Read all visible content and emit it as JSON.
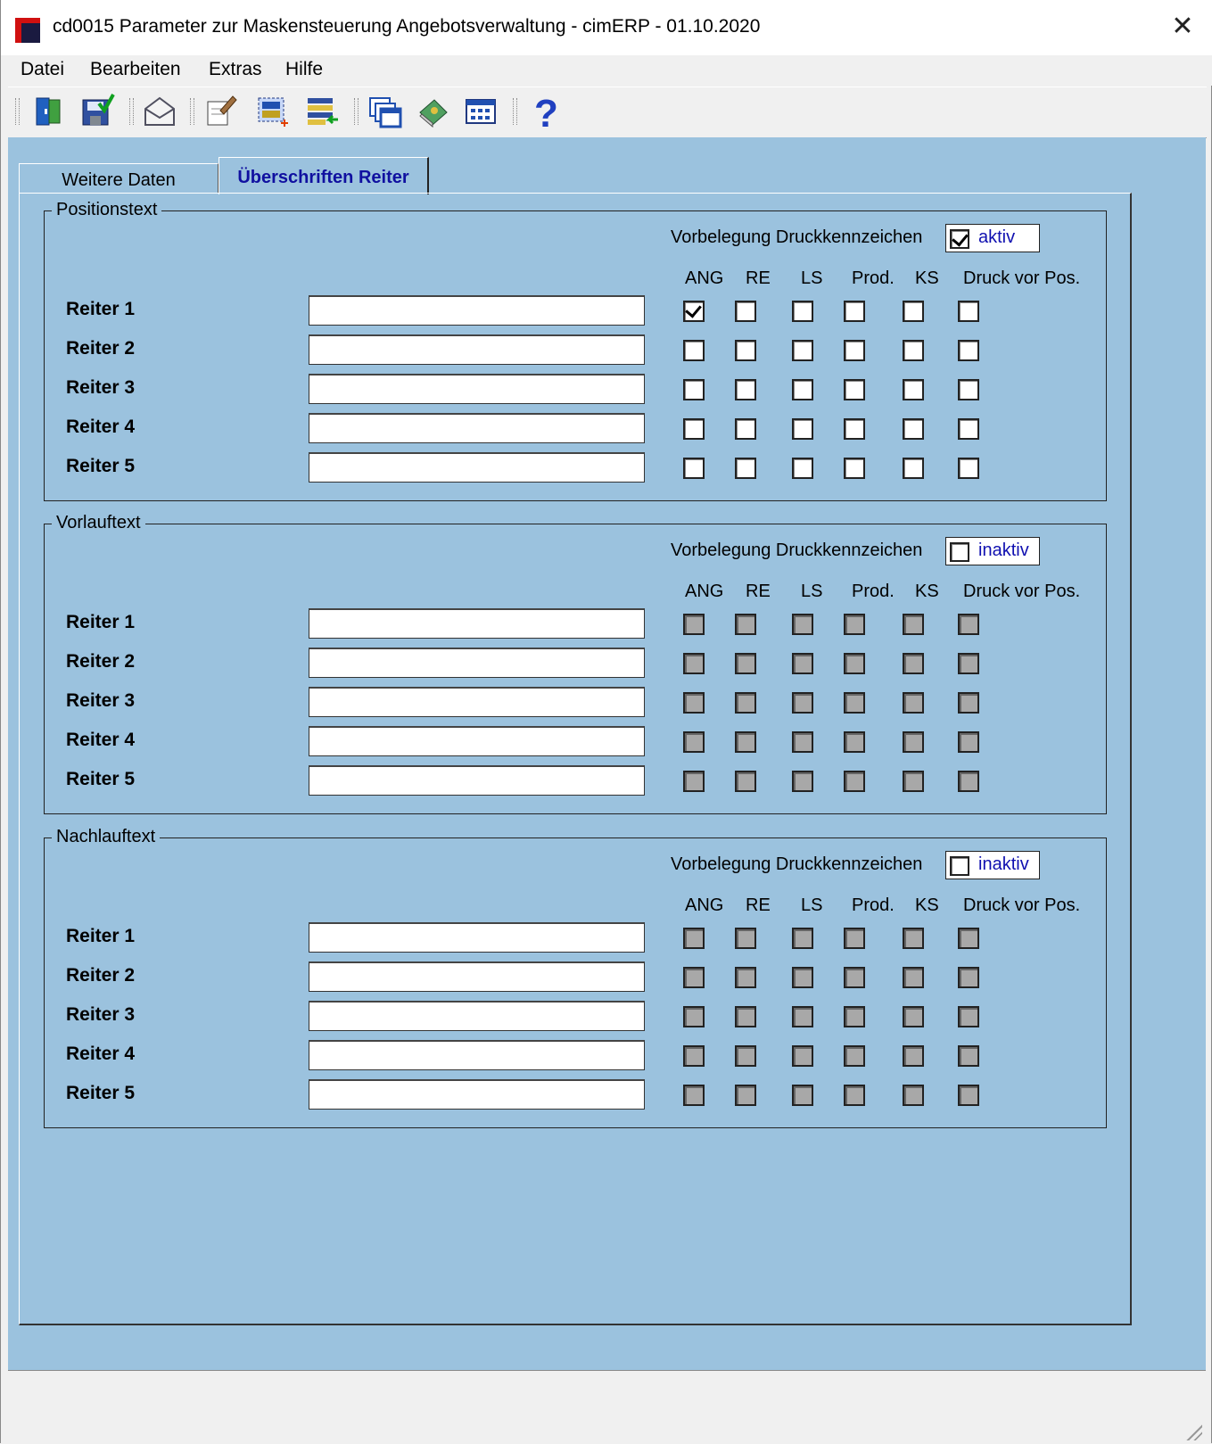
{
  "window": {
    "title": "cd0015 Parameter zur Maskensteuerung Angebotsverwaltung - cimERP - 01.10.2020",
    "close_glyph": "✕"
  },
  "menu": [
    "Datei",
    "Bearbeiten",
    "Extras",
    "Hilfe"
  ],
  "toolbar": [
    "exit-icon",
    "save-icon",
    "mail-icon",
    "edit-document-icon",
    "new-selection-icon",
    "import-list-icon",
    "windows-icon",
    "book-icon",
    "table-icon",
    "help-icon"
  ],
  "tabs": [
    {
      "label": "Weitere Daten",
      "active": false
    },
    {
      "label": "Überschriften Reiter",
      "active": true
    }
  ],
  "columns": [
    "ANG",
    "RE",
    "LS",
    "Prod.",
    "KS",
    "Druck vor Pos."
  ],
  "vorbelegung_label": "Vorbelegung Druckkennzeichen",
  "groups": [
    {
      "title": "Positionstext",
      "druck_state": "aktiv",
      "druck_checked": true,
      "enabled": true,
      "rows": [
        {
          "label": "Reiter 1",
          "value": "",
          "checks": [
            true,
            false,
            false,
            false,
            false,
            false
          ]
        },
        {
          "label": "Reiter 2",
          "value": "",
          "checks": [
            false,
            false,
            false,
            false,
            false,
            false
          ]
        },
        {
          "label": "Reiter 3",
          "value": "",
          "checks": [
            false,
            false,
            false,
            false,
            false,
            false
          ]
        },
        {
          "label": "Reiter 4",
          "value": "",
          "checks": [
            false,
            false,
            false,
            false,
            false,
            false
          ]
        },
        {
          "label": "Reiter 5",
          "value": "",
          "checks": [
            false,
            false,
            false,
            false,
            false,
            false
          ]
        }
      ]
    },
    {
      "title": "Vorlauftext",
      "druck_state": "inaktiv",
      "druck_checked": false,
      "enabled": false,
      "rows": [
        {
          "label": "Reiter 1",
          "value": "",
          "checks": [
            false,
            false,
            false,
            false,
            false,
            false
          ]
        },
        {
          "label": "Reiter 2",
          "value": "",
          "checks": [
            false,
            false,
            false,
            false,
            false,
            false
          ]
        },
        {
          "label": "Reiter 3",
          "value": "",
          "checks": [
            false,
            false,
            false,
            false,
            false,
            false
          ]
        },
        {
          "label": "Reiter 4",
          "value": "",
          "checks": [
            false,
            false,
            false,
            false,
            false,
            false
          ]
        },
        {
          "label": "Reiter 5",
          "value": "",
          "checks": [
            false,
            false,
            false,
            false,
            false,
            false
          ]
        }
      ]
    },
    {
      "title": "Nachlauftext",
      "druck_state": "inaktiv",
      "druck_checked": false,
      "enabled": false,
      "rows": [
        {
          "label": "Reiter 1",
          "value": "",
          "checks": [
            false,
            false,
            false,
            false,
            false,
            false
          ]
        },
        {
          "label": "Reiter 2",
          "value": "",
          "checks": [
            false,
            false,
            false,
            false,
            false,
            false
          ]
        },
        {
          "label": "Reiter 3",
          "value": "",
          "checks": [
            false,
            false,
            false,
            false,
            false,
            false
          ]
        },
        {
          "label": "Reiter 4",
          "value": "",
          "checks": [
            false,
            false,
            false,
            false,
            false,
            false
          ]
        },
        {
          "label": "Reiter 5",
          "value": "",
          "checks": [
            false,
            false,
            false,
            false,
            false,
            false
          ]
        }
      ]
    }
  ],
  "colors": {
    "client_bg": "#9bc2de",
    "accent_text": "#1010b0",
    "title_bg": "#ffffff"
  }
}
